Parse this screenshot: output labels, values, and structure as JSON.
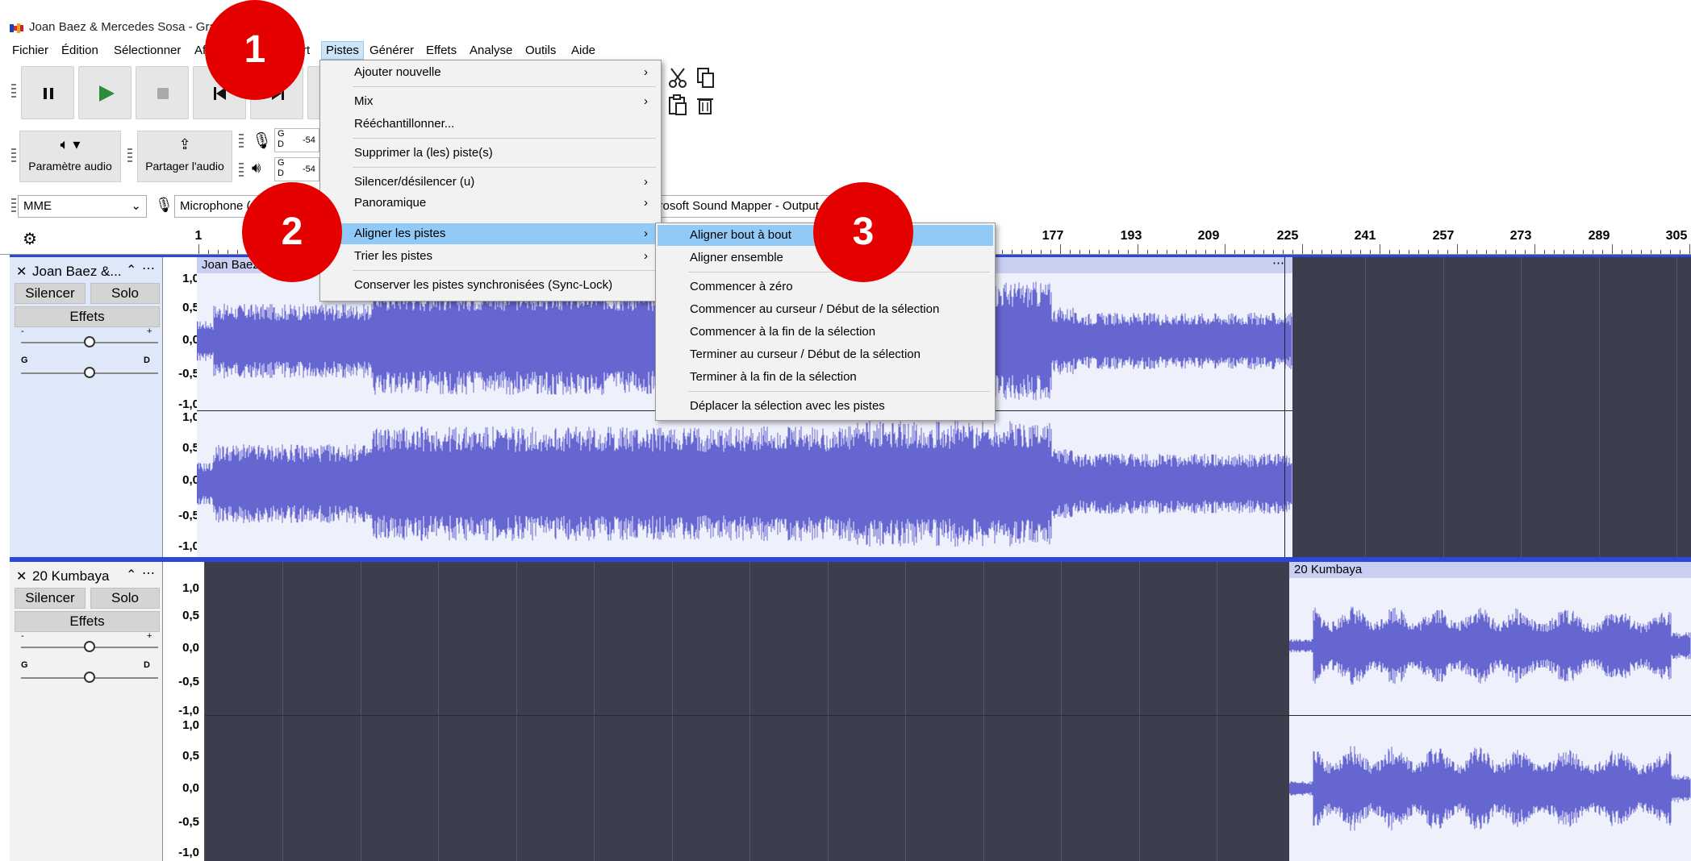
{
  "window": {
    "title": "Joan Baez & Mercedes Sosa - Grac"
  },
  "menubar": {
    "items": [
      "Fichier",
      "Édition",
      "Sélectionner",
      "Af",
      "rt",
      "Pistes",
      "Générer",
      "Effets",
      "Analyse",
      "Outils",
      "Aide"
    ],
    "active": "Pistes"
  },
  "toolbar": {
    "audio_setup_label": "Paramètre audio",
    "share_audio_label": "Partager l'audio",
    "meter_rec_gd": "G\nD",
    "meter_rec_value": "-54",
    "meter_play_value": "-54"
  },
  "devices": {
    "host": "MME",
    "recording_device": "Microphone (",
    "playback_device": "crosoft Sound Mapper - Output"
  },
  "ruler": {
    "labels": [
      "1",
      "177",
      "193",
      "209",
      "225",
      "241",
      "257",
      "273",
      "289",
      "305"
    ]
  },
  "tracks": [
    {
      "name": "Joan Baez &...",
      "clip_name": "Joan Baez & ",
      "mute_label": "Silencer",
      "solo_label": "Solo",
      "effects_label": "Effets",
      "pan_left": "G",
      "pan_right": "D",
      "gain_minus": "-",
      "gain_plus": "+",
      "scale": [
        "1,0",
        "0,5",
        "0,0",
        "-0,5",
        "-1,0"
      ]
    },
    {
      "name": "20 Kumbaya",
      "clip_name": "20 Kumbaya",
      "mute_label": "Silencer",
      "solo_label": "Solo",
      "effects_label": "Effets",
      "pan_left": "G",
      "pan_right": "D",
      "gain_minus": "-",
      "gain_plus": "+",
      "scale": [
        "1,0",
        "0,5",
        "0,0",
        "-0,5",
        "-1,0"
      ]
    }
  ],
  "pistes_menu": {
    "items": [
      {
        "label": "Ajouter nouvelle",
        "submenu": true
      },
      {
        "label": "Mix",
        "submenu": true
      },
      {
        "label": "Rééchantillonner...",
        "submenu": false
      },
      {
        "label": "Supprimer la (les) piste(s)",
        "submenu": false
      },
      {
        "label": "Silencer/désilencer (u)",
        "submenu": true
      },
      {
        "label": "Panoramique",
        "submenu": true
      },
      {
        "label": "Aligner les pistes",
        "submenu": true
      },
      {
        "label": "Trier les pistes",
        "submenu": true
      },
      {
        "label": "Conserver les pistes synchronisées (Sync-Lock)",
        "submenu": false
      }
    ]
  },
  "align_submenu": {
    "items": [
      "Aligner bout à bout",
      "Aligner ensemble",
      "Commencer à zéro",
      "Commencer au curseur / Début de la sélection",
      "Commencer à la fin de la sélection",
      "Terminer au curseur / Début de la sélection",
      "Terminer à la fin de la sélection",
      "Déplacer la sélection avec les pistes"
    ]
  },
  "annotations": [
    "1",
    "2",
    "3"
  ],
  "colors": {
    "wave": "#6666d0",
    "highlight": "#91c9f7",
    "badge": "#e50000",
    "track_bg": "#3c3e4e"
  }
}
